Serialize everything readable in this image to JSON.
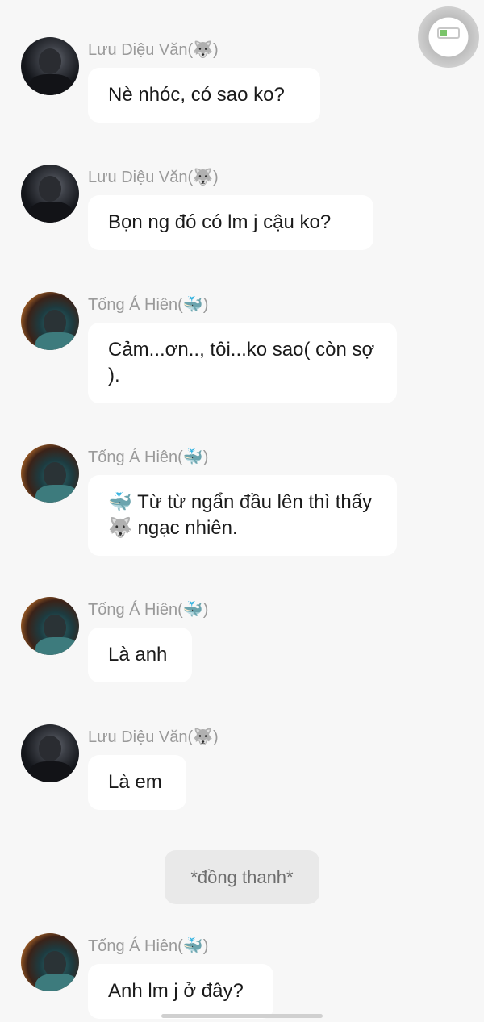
{
  "messages": [
    {
      "id": "m1",
      "sender": "Lưu Diệu Văn",
      "sender_emoji": "🐺",
      "text": "Nè nhóc, có sao ko?",
      "avatar": "luu"
    },
    {
      "id": "m2",
      "sender": "Lưu Diệu Văn",
      "sender_emoji": "🐺",
      "text": "Bọn ng đó có lm j cậu ko?",
      "avatar": "luu"
    },
    {
      "id": "m3",
      "sender": "Tống Á Hiên",
      "sender_emoji": "🐳",
      "text": "Cảm...ơn.., tôi...ko sao( còn sợ ).",
      "avatar": "tong"
    },
    {
      "id": "m4",
      "sender": "Tống Á Hiên",
      "sender_emoji": "🐳",
      "text": "🐳 Từ từ ngẩn đầu lên thì thấy 🐺 ngạc nhiên.",
      "avatar": "tong"
    },
    {
      "id": "m5",
      "sender": "Tống Á Hiên",
      "sender_emoji": "🐳",
      "text": "Là anh",
      "avatar": "tong"
    },
    {
      "id": "m6",
      "sender": "Lưu Diệu Văn",
      "sender_emoji": "🐺",
      "text": "Là em",
      "avatar": "luu"
    },
    {
      "id": "m8",
      "sender": "Tống Á Hiên",
      "sender_emoji": "🐳",
      "text": "Anh lm j ở đây?",
      "avatar": "tong"
    }
  ],
  "narration": "*đồng thanh*",
  "status_icon": "battery-icon",
  "colors": {
    "background": "#f7f7f7",
    "bubble": "#ffffff",
    "narration_bubble": "#e9e9e9",
    "name_text": "#9a9a9a",
    "battery": "#7ac46a"
  }
}
